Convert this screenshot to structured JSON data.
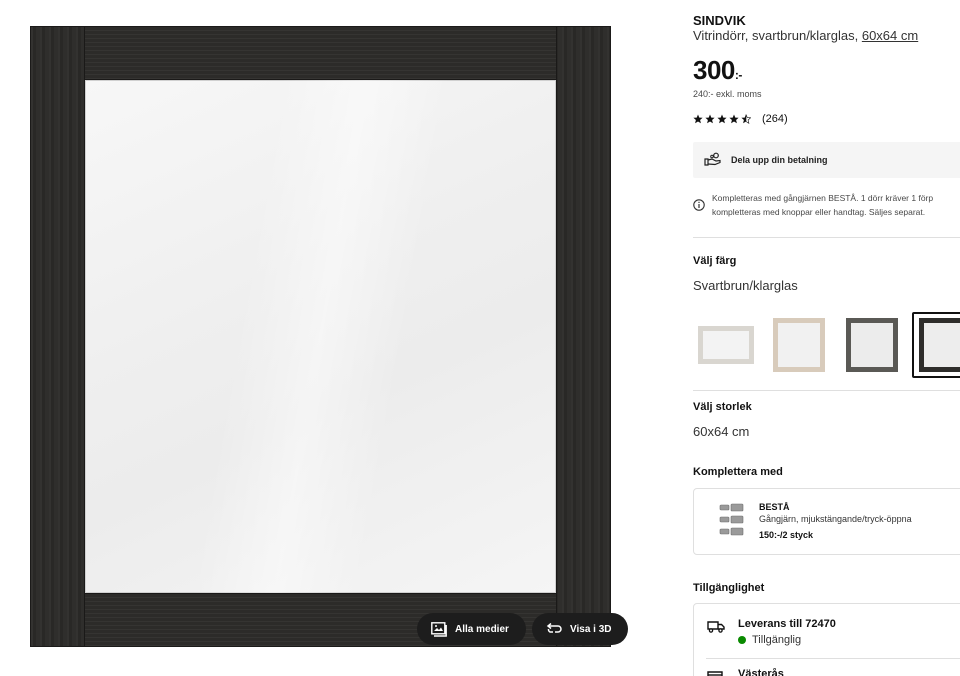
{
  "media": {
    "all_media_label": "Alla medier",
    "view_3d_label": "Visa i 3D"
  },
  "product": {
    "name": "SINDVIK",
    "description": "Vitrindörr, svartbrun/klarglas, ",
    "size_link": "60x64 cm",
    "price": "300",
    "price_suffix": ":-",
    "price_ex_vat": "240:- exkl. moms",
    "rating_value": 4.5,
    "review_count": "(264)"
  },
  "payment": {
    "label": "Dela upp din betalning"
  },
  "note": {
    "line1": "Kompletteras med gångjärnen BESTÅ. 1 dörr kräver 1 förp",
    "line2": "kompletteras med knoppar eller handtag. Säljes separat."
  },
  "color": {
    "title": "Välj färg",
    "selected": "Svartbrun/klarglas",
    "swatches": [
      {
        "name": "white",
        "frame": "#d9d6d0",
        "selected": false
      },
      {
        "name": "white-stained-oak",
        "frame": "#d8cbbb",
        "selected": false
      },
      {
        "name": "grey",
        "frame": "#5a5955",
        "selected": false
      },
      {
        "name": "black-brown",
        "frame": "#2e2d2b",
        "selected": true
      }
    ]
  },
  "size": {
    "title": "Välj storlek",
    "selected": "60x64 cm"
  },
  "complete": {
    "title": "Komplettera med",
    "item_name": "BESTÅ",
    "item_desc": "Gångjärn, mjukstängande/tryck-öppna",
    "item_price": "150:-/2 styck"
  },
  "availability": {
    "title": "Tillgänglighet",
    "delivery_title": "Leverans till 72470",
    "delivery_status": "Tillgänglig",
    "store_title": "Västerås"
  },
  "colors": {
    "status_green": "#0a8a00",
    "pill_bg": "#1d1d1d"
  }
}
